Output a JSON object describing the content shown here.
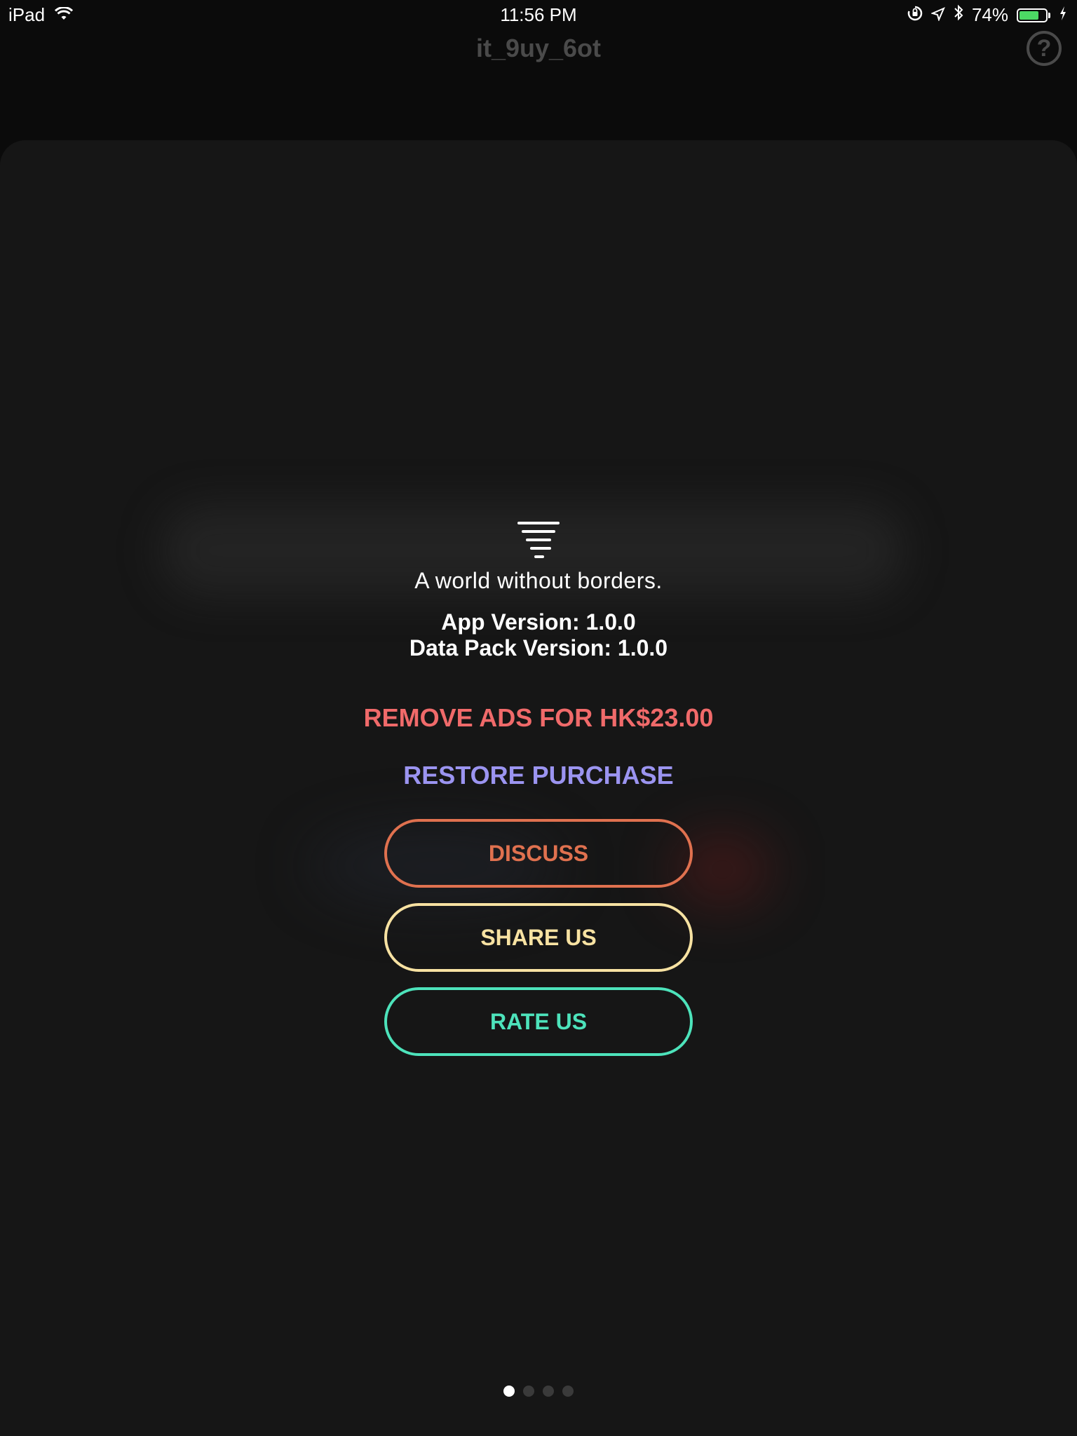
{
  "status_bar": {
    "device": "iPad",
    "time": "11:56 PM",
    "battery_percent": "74%",
    "battery_level": 0.74,
    "icons": [
      "wifi-icon",
      "orientation-lock-icon",
      "location-icon",
      "bluetooth-icon",
      "battery-icon",
      "charging-icon"
    ]
  },
  "nav": {
    "title": "it_9uy_6ot",
    "help_label": "?"
  },
  "about": {
    "tagline": "A world without borders.",
    "app_version": "App Version: 1.0.0",
    "data_version": "Data Pack Version: 1.0.0"
  },
  "actions": {
    "remove_ads": "REMOVE ADS FOR HK$23.00",
    "restore": "RESTORE PURCHASE",
    "discuss": "DISCUSS",
    "share": "SHARE US",
    "rate": "RATE US"
  },
  "colors": {
    "remove_ads": "#f06a6a",
    "restore": "#9b94f0",
    "discuss": "#e0714f",
    "share": "#f7e2a2",
    "rate": "#4de3bb",
    "title": "#4a4a4a"
  },
  "pager": {
    "total": 4,
    "current": 1
  }
}
